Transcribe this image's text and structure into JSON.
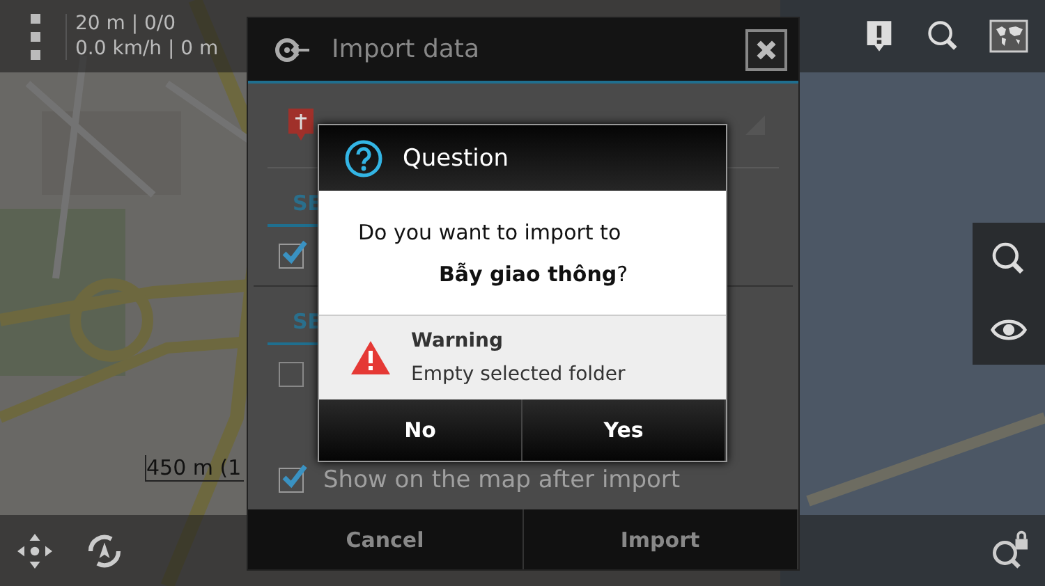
{
  "status_panel": {
    "lines": [
      "20 m | 0/0",
      "0.0 km/h | 0 m"
    ]
  },
  "map": {
    "kind": "picture",
    "scale": "450 m (1"
  },
  "import_dialog": {
    "title": "Import data",
    "sections": [
      {
        "heading": "SE",
        "rows": [
          {
            "checked": true
          }
        ]
      },
      {
        "heading": "SE",
        "rows": [
          {
            "checked": false
          },
          {
            "checked": true,
            "label": "Show on the map after import"
          }
        ]
      }
    ],
    "buttons": [
      "Cancel",
      "Import"
    ]
  },
  "question_dialog": {
    "title": "Question",
    "message": "Do you want to import to",
    "target": "**Bẫy giao thông**?",
    "warning": {
      "title": "Warning",
      "text": "Empty selected folder"
    },
    "buttons": [
      "No",
      "Yes"
    ]
  }
}
